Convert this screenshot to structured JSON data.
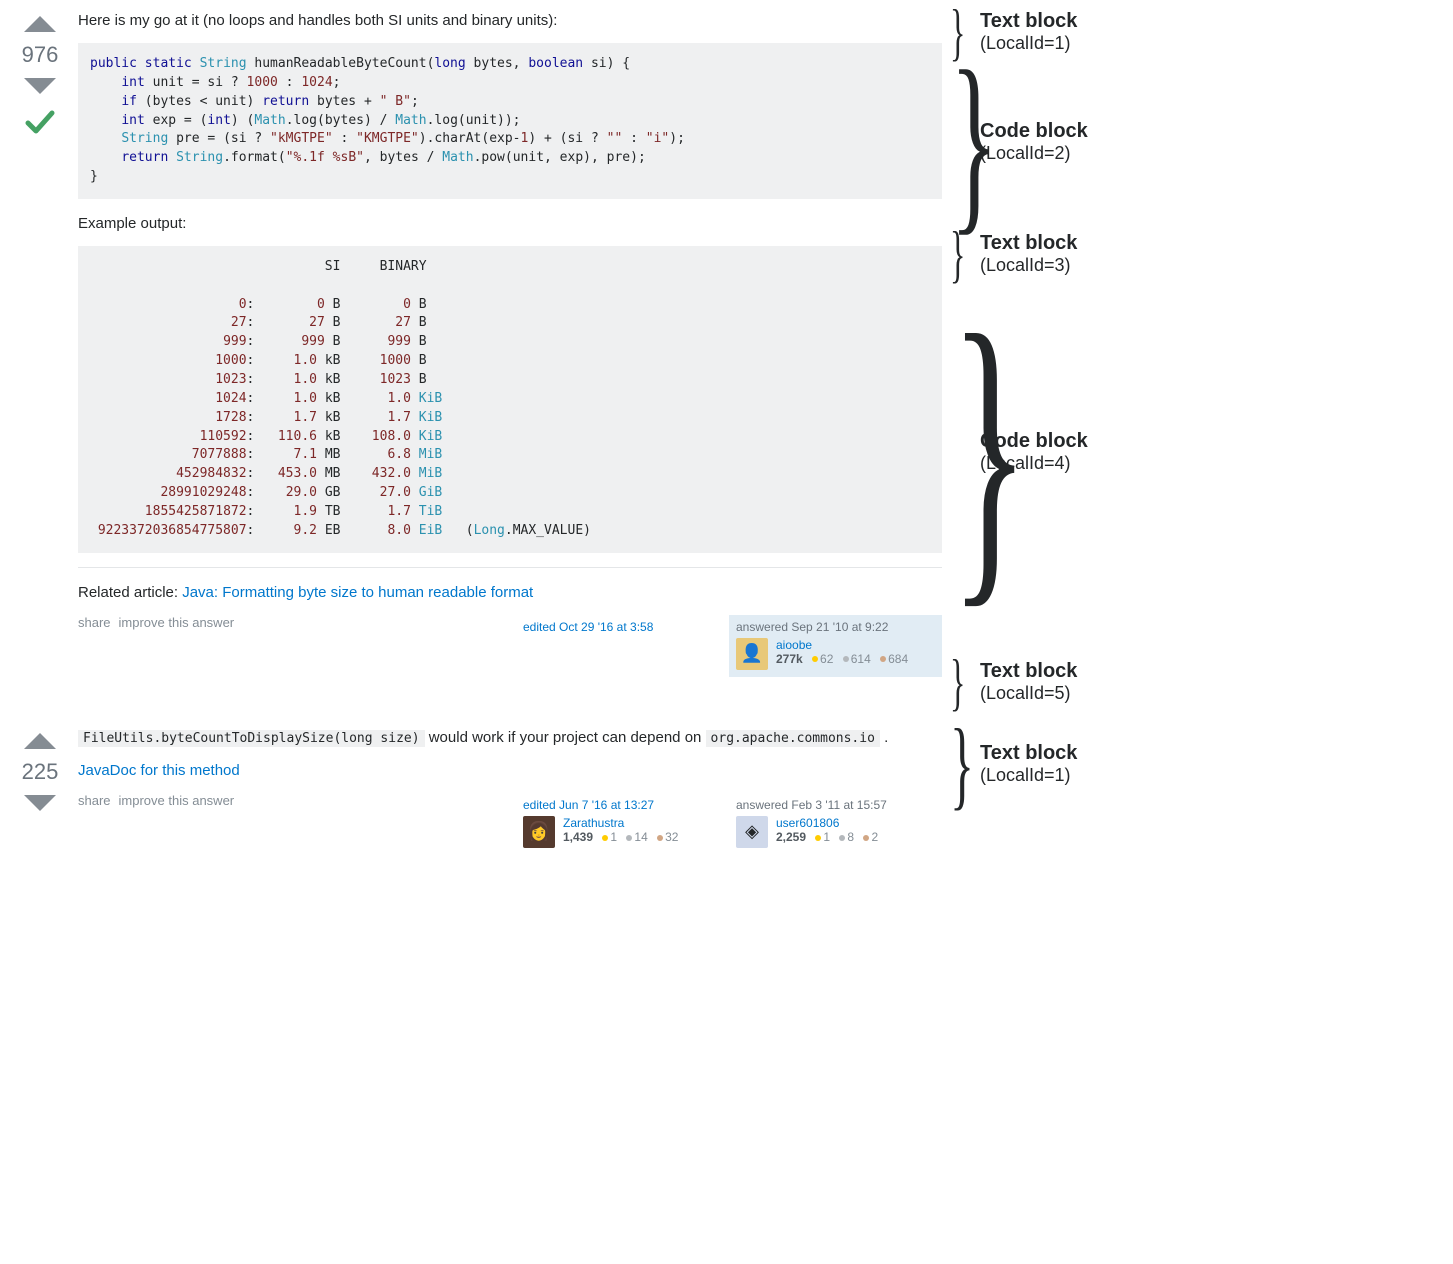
{
  "answer1": {
    "votes": "976",
    "accepted": true,
    "text1": "Here is my go at it (no loops and handles both SI units and binary units):",
    "code1_html": "<span class='kw'>public</span> <span class='kw'>static</span> <span class='type'>String</span> humanReadableByteCount(<span class='kw'>long</span> bytes, <span class='kw'>boolean</span> si) {\n    <span class='kw'>int</span> unit = si ? <span class='num'>1000</span> : <span class='num'>1024</span>;\n    <span class='kw'>if</span> (bytes &lt; unit) <span class='kw'>return</span> bytes + <span class='str'>\" B\"</span>;\n    <span class='kw'>int</span> exp = (<span class='kw'>int</span>) (<span class='type'>Math</span>.log(bytes) / <span class='type'>Math</span>.log(unit));\n    <span class='type'>String</span> pre = (si ? <span class='str'>\"kMGTPE\"</span> : <span class='str'>\"KMGTPE\"</span>).charAt(exp-<span class='num'>1</span>) + (si ? <span class='str'>\"\"</span> : <span class='str'>\"i\"</span>);\n    <span class='kw'>return</span> <span class='type'>String</span>.format(<span class='str'>\"%.1f %sB\"</span>, bytes / <span class='type'>Math</span>.pow(unit, exp), pre);\n}",
    "text2": "Example output:",
    "code2_html": "                              SI     BINARY\n\n                   <span class='num'>0</span>:        <span class='num'>0</span> B        <span class='num'>0</span> B\n                  <span class='num'>27</span>:       <span class='num'>27</span> B       <span class='num'>27</span> B\n                 <span class='num'>999</span>:      <span class='num'>999</span> B      <span class='num'>999</span> B\n                <span class='num'>1000</span>:     <span class='num'>1.0</span> kB     <span class='num'>1000</span> B\n                <span class='num'>1023</span>:     <span class='num'>1.0</span> kB     <span class='num'>1023</span> B\n                <span class='num'>1024</span>:     <span class='num'>1.0</span> kB      <span class='num'>1.0</span> <span class='type'>KiB</span>\n                <span class='num'>1728</span>:     <span class='num'>1.7</span> kB      <span class='num'>1.7</span> <span class='type'>KiB</span>\n              <span class='num'>110592</span>:   <span class='num'>110.6</span> kB    <span class='num'>108.0</span> <span class='type'>KiB</span>\n             <span class='num'>7077888</span>:     <span class='num'>7.1</span> MB      <span class='num'>6.8</span> <span class='type'>MiB</span>\n           <span class='num'>452984832</span>:   <span class='num'>453.0</span> MB    <span class='num'>432.0</span> <span class='type'>MiB</span>\n         <span class='num'>28991029248</span>:    <span class='num'>29.0</span> GB     <span class='num'>27.0</span> <span class='type'>GiB</span>\n       <span class='num'>1855425871872</span>:     <span class='num'>1.9</span> TB      <span class='num'>1.7</span> <span class='type'>TiB</span>\n <span class='num'>9223372036854775807</span>:     <span class='num'>9.2</span> EB      <span class='num'>8.0</span> <span class='type'>EiB</span>   (<span class='type'>Long</span>.MAX_VALUE)",
    "related_prefix": "Related article: ",
    "related_link": "Java: Formatting byte size to human readable format",
    "share": "share",
    "improve": "improve this answer",
    "edited_action": "edited Oct 29 '16 at 3:58",
    "answered_action": "answered Sep 21 '10 at 9:22",
    "author": {
      "name": "aioobe",
      "rep": "277k",
      "gold": "62",
      "silver": "614",
      "bronze": "684"
    }
  },
  "answer2": {
    "votes": "225",
    "inline_code": "FileUtils.byteCountToDisplaySize(long size)",
    "text_mid": " would work if your project can depend on ",
    "inline_code2": "org.apache.commons.io",
    "text_end": " .",
    "javadoc_link": "JavaDoc for this method",
    "share": "share",
    "improve": "improve this answer",
    "edited_action": "edited Jun 7 '16 at 13:27",
    "editor": {
      "name": "Zarathustra",
      "rep": "1,439",
      "gold": "1",
      "silver": "14",
      "bronze": "32"
    },
    "answered_action": "answered Feb 3 '11 at 15:57",
    "author": {
      "name": "user601806",
      "rep": "2,259",
      "gold": "1",
      "silver": "8",
      "bronze": "2"
    }
  },
  "annotations": {
    "a1": {
      "label": "Text block",
      "sub": "(LocalId=1)"
    },
    "a2": {
      "label": "Code block",
      "sub": "(LocalId=2)"
    },
    "a3": {
      "label": "Text block",
      "sub": "(LocalId=3)"
    },
    "a4": {
      "label": "Code block",
      "sub": "(LocalId=4)"
    },
    "a5": {
      "label": "Text block",
      "sub": "(LocalId=5)"
    },
    "a6": {
      "label": "Text block",
      "sub": "(LocalId=1)"
    }
  }
}
